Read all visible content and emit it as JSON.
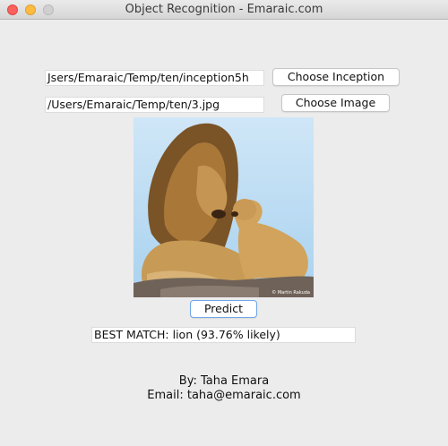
{
  "window": {
    "title": "Object Recognition - Emaraic.com"
  },
  "inception": {
    "path": "Jsers/Emaraic/Temp/ten/inception5h",
    "button_label": "Choose Inception"
  },
  "image": {
    "path": "/Users/Emaraic/Temp/ten/3.jpg",
    "button_label": "Choose Image",
    "credit": "© Martin Rakuda"
  },
  "predict": {
    "button_label": "Predict"
  },
  "result": {
    "text": "BEST MATCH: lion (93.76% likely)"
  },
  "footer": {
    "by": "By: Taha Emara",
    "email": "Email: taha@emaraic.com"
  }
}
